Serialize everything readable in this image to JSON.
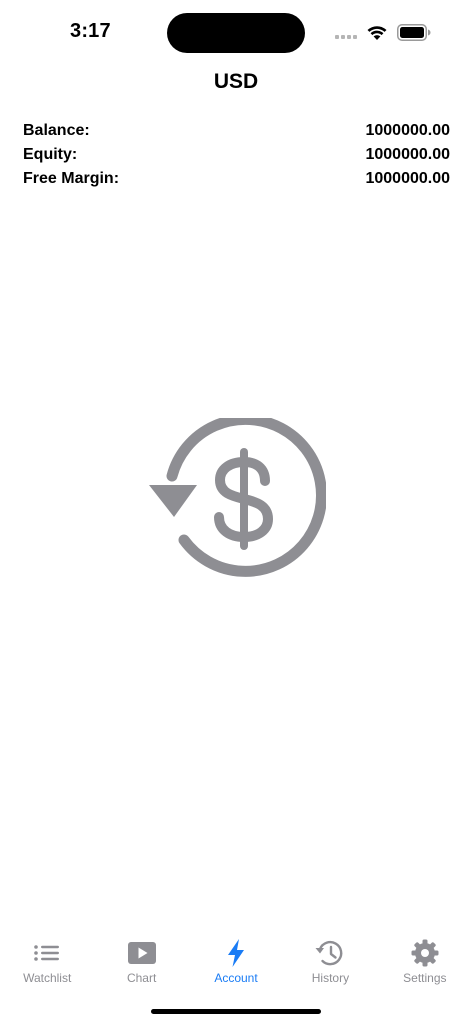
{
  "status_bar": {
    "time": "3:17"
  },
  "header": {
    "title": "USD"
  },
  "account": {
    "rows": [
      {
        "label": "Balance:",
        "value": "1000000.00"
      },
      {
        "label": "Equity:",
        "value": "1000000.00"
      },
      {
        "label": "Free Margin:",
        "value": "1000000.00"
      }
    ]
  },
  "center_icon": "dollar-refresh-icon",
  "tab_bar": {
    "items": [
      {
        "label": "Watchlist",
        "icon": "list-icon",
        "active": false
      },
      {
        "label": "Chart",
        "icon": "play-icon",
        "active": false
      },
      {
        "label": "Account",
        "icon": "bolt-icon",
        "active": true
      },
      {
        "label": "History",
        "icon": "history-icon",
        "active": false
      },
      {
        "label": "Settings",
        "icon": "gear-icon",
        "active": false
      }
    ]
  },
  "colors": {
    "accent": "#1a7cf5",
    "inactive": "#8e8e93",
    "icon_gray": "#8e8e93"
  }
}
